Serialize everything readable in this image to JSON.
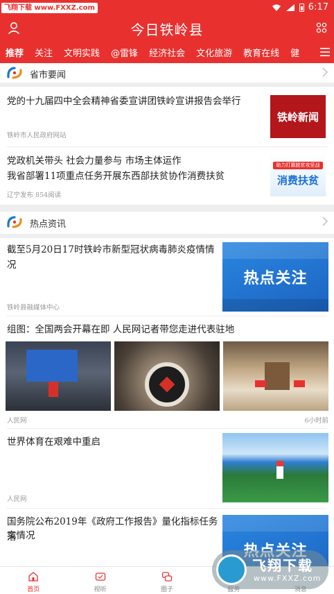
{
  "statusbar": {
    "watermark": "飞翔下载 www.FXXZ.com",
    "time": "6:17"
  },
  "app": {
    "title": "今日铁岭县"
  },
  "nav": {
    "items": [
      "推荐",
      "关注",
      "文明实践",
      "@雷锋",
      "经济社会",
      "文化旅游",
      "教育在线",
      "健"
    ]
  },
  "sections": {
    "province": "省市要闻",
    "hot": "热点资讯"
  },
  "news": [
    {
      "title": "党的十九届四中全会精神省委宣讲团铁岭宣讲报告会举行",
      "source": "铁岭市人民政府网站",
      "thumb": "铁岭新闻"
    },
    {
      "title_line1": "党政机关带头 社会力量参与 市场主体运作",
      "title_line2": "我省部署11项重点任务开展东西部扶贫协作消费扶贫",
      "source": "辽宁发布 854阅读",
      "thumb_top": "助力打赢脱贫攻坚战",
      "thumb_main": "消费扶贫"
    },
    {
      "title": "截至5月20日17时铁岭市新型冠状病毒肺炎疫情情况",
      "source": "铁岭县融媒体中心",
      "thumb": "热点关注"
    },
    {
      "title": "组图：全国两会开幕在即 人民网记者带您走进代表驻地",
      "source": "人民网",
      "time": "6小时前"
    },
    {
      "title": "世界体育在艰难中重启",
      "source": "人民网"
    },
    {
      "title_line1": "国务院公布2019年《政府工作报告》量化指标任务落",
      "title_line2": "实情况",
      "thumb": "热点关注"
    }
  ],
  "tabbar": {
    "items": [
      "首页",
      "视听",
      "圈子",
      "服务",
      "消息"
    ]
  },
  "bottom_watermark": {
    "main": "飞翔下载",
    "sub": "www.FXXZ.com"
  },
  "colors": {
    "brand": "#e8312f",
    "hot_blue": "#2a87e0"
  }
}
